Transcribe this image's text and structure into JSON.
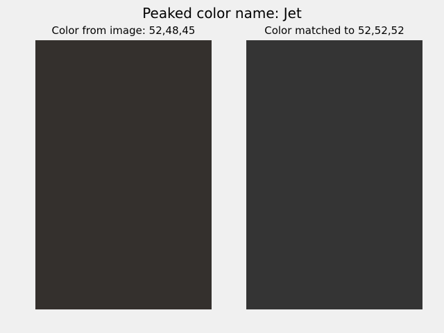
{
  "title": "Peaked color name: Jet",
  "panels": [
    {
      "label": "Color from image: 52,48,45",
      "color": "#34302d"
    },
    {
      "label": "Color matched to 52,52,52",
      "color": "#343434"
    }
  ]
}
